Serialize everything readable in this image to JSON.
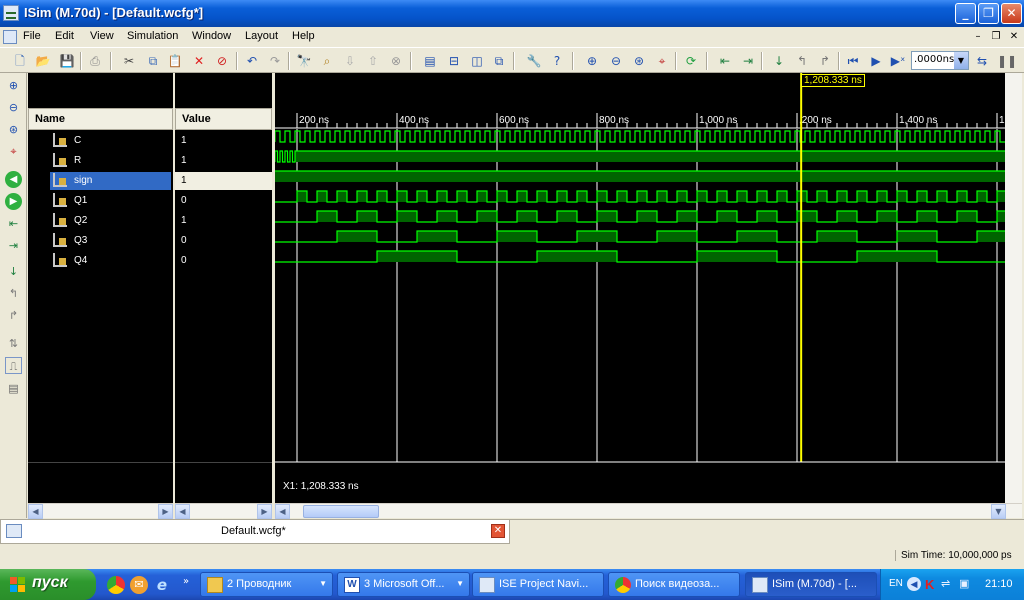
{
  "window": {
    "title": "ISim (M.70d) - [Default.wcfg*]"
  },
  "menu": [
    "File",
    "Edit",
    "View",
    "Simulation",
    "Window",
    "Layout",
    "Help"
  ],
  "toolbar": {
    "time_value": ".0000ns"
  },
  "columns": {
    "name": "Name",
    "value": "Value"
  },
  "signals": [
    {
      "name": "C",
      "value": "1"
    },
    {
      "name": "R",
      "value": "1"
    },
    {
      "name": "sign",
      "value": "1",
      "selected": true
    },
    {
      "name": "Q1",
      "value": "0"
    },
    {
      "name": "Q2",
      "value": "1"
    },
    {
      "name": "Q3",
      "value": "0"
    },
    {
      "name": "Q4",
      "value": "0"
    }
  ],
  "timeline": {
    "ticks": [
      "200 ns",
      "400 ns",
      "600 ns",
      "800 ns",
      "1,000 ns",
      ",200 ns",
      "1,400 ns",
      "1"
    ],
    "cursor_label": "1,208.333 ns",
    "cursor_ns": 1208.333,
    "x1_readout": "X1: 1,208.333 ns"
  },
  "colors": {
    "waveform": "#00ff00",
    "cursor": "#ffff00",
    "grid": "#ffffff",
    "background": "#000000"
  },
  "doc_tab": {
    "label": "Default.wcfg*"
  },
  "status": {
    "sim_time": "Sim Time: 10,000,000 ps"
  },
  "taskbar": {
    "start": "пуск",
    "tasks": [
      {
        "label": "2 Проводник",
        "icon": "folder-icon"
      },
      {
        "label": "3 Microsoft Off...",
        "icon": "word-icon"
      },
      {
        "label": "ISE Project Navi...",
        "icon": "ise-icon"
      },
      {
        "label": "Поиск видеоза...",
        "icon": "chrome-icon"
      },
      {
        "label": "ISim (M.70d) - [...",
        "icon": "isim-icon",
        "active": true
      }
    ],
    "lang": "EN",
    "clock": "21:10"
  }
}
